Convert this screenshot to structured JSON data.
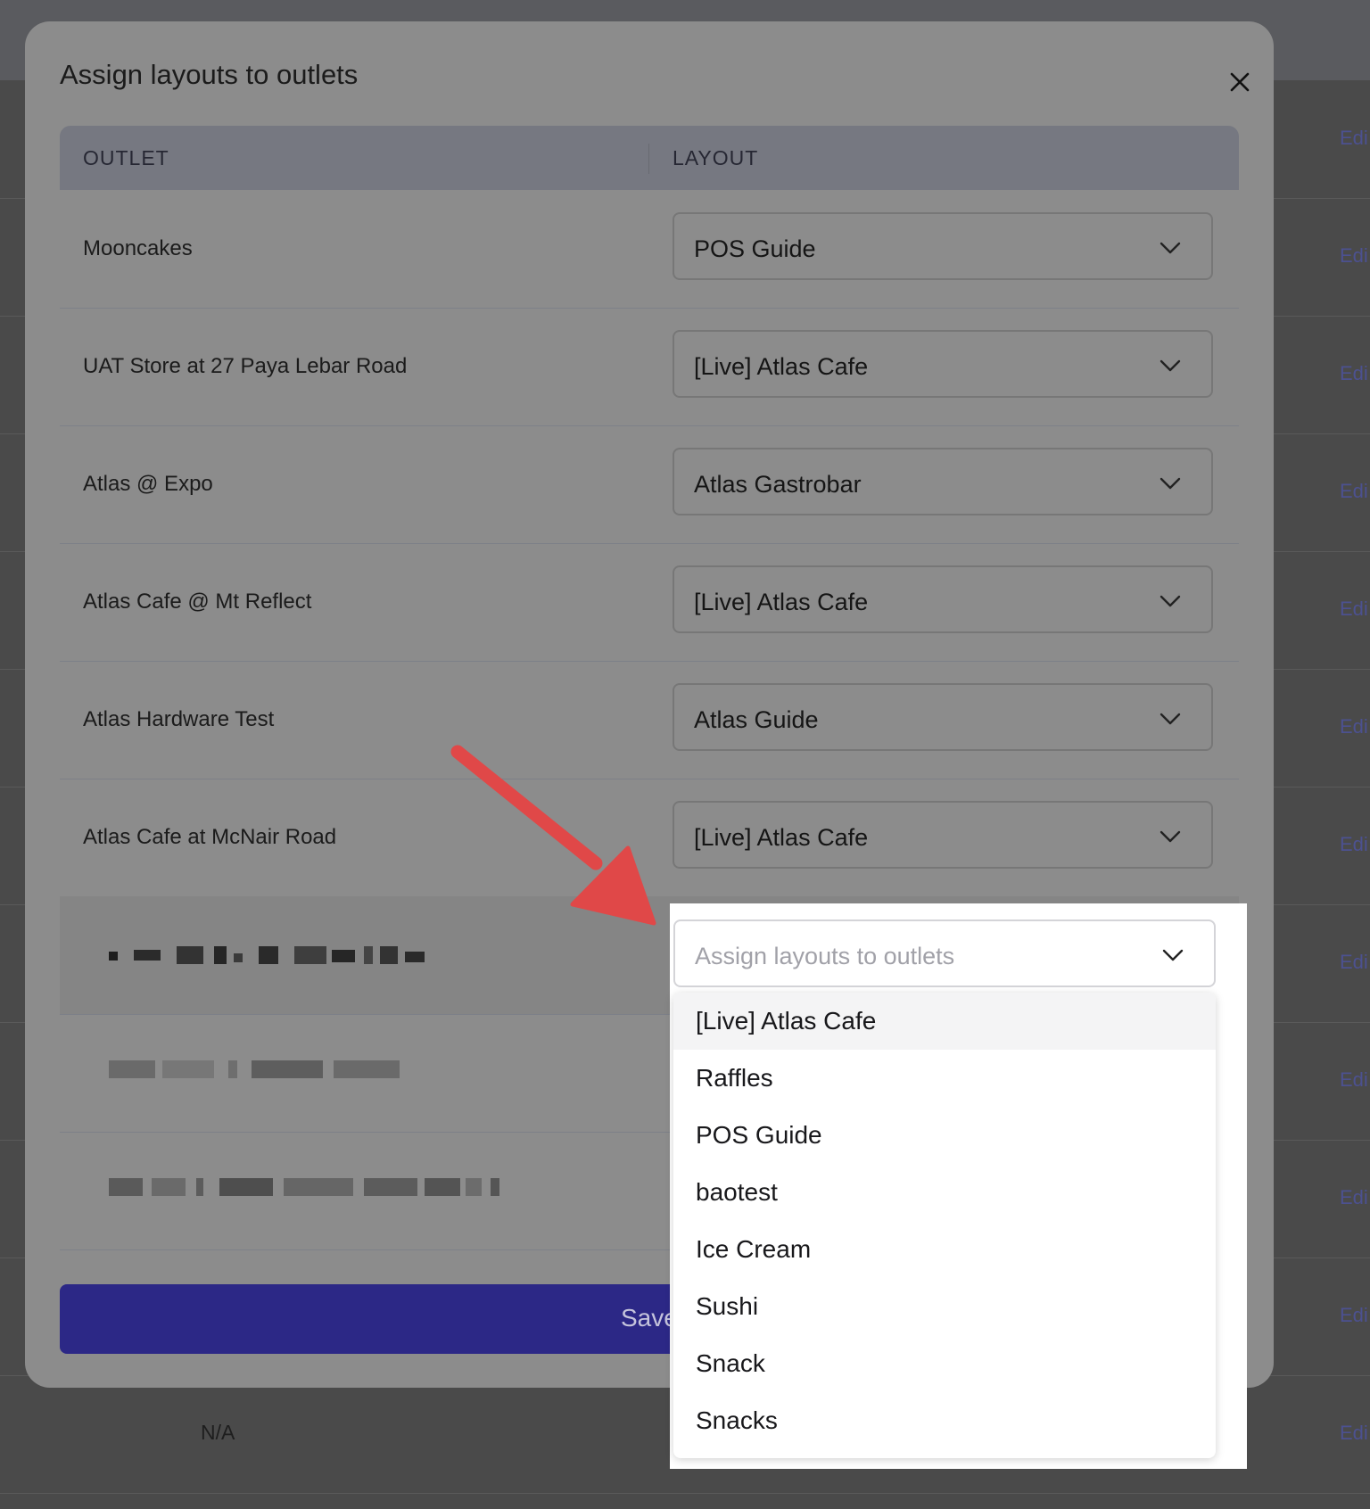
{
  "background": {
    "row_action_label": "Edi",
    "na_label": "N/A"
  },
  "modal": {
    "title": "Assign layouts to outlets",
    "columns": {
      "outlet": "OUTLET",
      "layout": "LAYOUT"
    },
    "rows": [
      {
        "outlet": "Mooncakes",
        "layout": "POS Guide"
      },
      {
        "outlet": "UAT Store at 27 Paya Lebar Road",
        "layout": "[Live] Atlas Cafe"
      },
      {
        "outlet": "Atlas @ Expo",
        "layout": "Atlas Gastrobar"
      },
      {
        "outlet": "Atlas Cafe @ Mt Reflect",
        "layout": "[Live] Atlas Cafe"
      },
      {
        "outlet": "Atlas Hardware Test",
        "layout": "Atlas Guide"
      },
      {
        "outlet": "Atlas Cafe at McNair Road",
        "layout": "[Live] Atlas Cafe"
      }
    ],
    "save_label": "Save"
  },
  "dropdown": {
    "placeholder": "Assign layouts to outlets",
    "options": [
      "[Live] Atlas Cafe",
      "Raffles",
      "POS Guide",
      "baotest",
      "Ice Cream",
      "Sushi",
      "Snack",
      "Snacks"
    ],
    "highlighted_index": 0
  },
  "colors": {
    "primary_button": "#2c2886",
    "annotation_arrow": "#e04848"
  }
}
